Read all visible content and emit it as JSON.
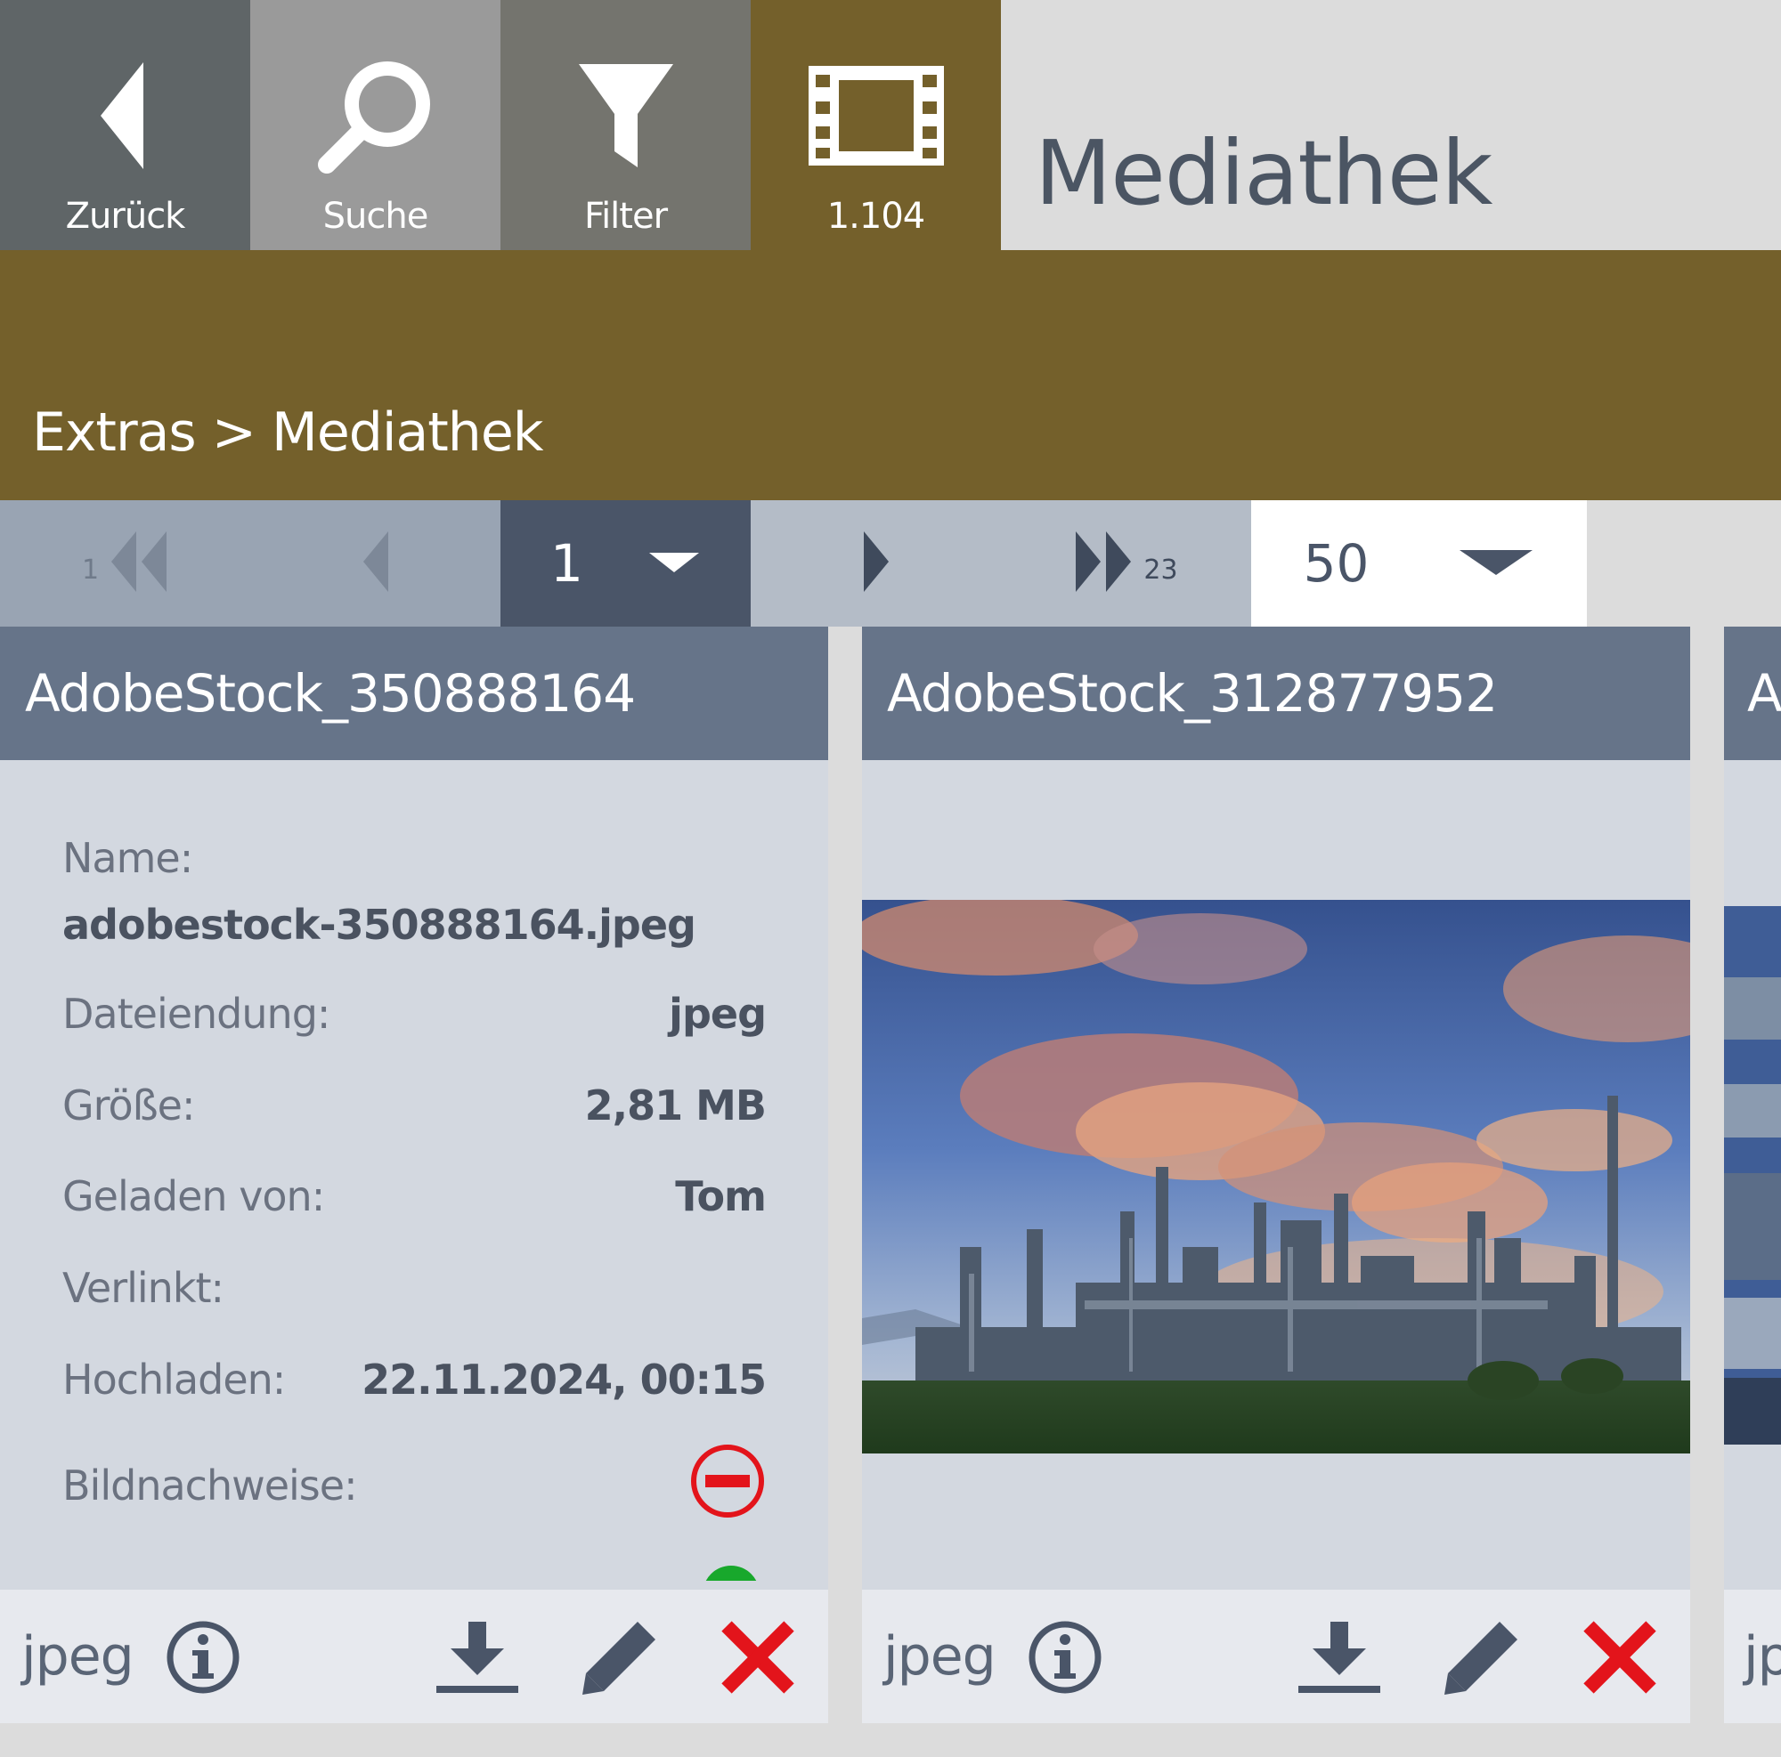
{
  "toolbar": {
    "back_label": "Zurück",
    "search_label": "Suche",
    "filter_label": "Filter",
    "media_count": "1.104",
    "title": "Mediathek"
  },
  "breadcrumb": "Extras > Mediathek",
  "pagination": {
    "first_page": "1",
    "current_page": "1",
    "last_page": "23",
    "page_size": "50"
  },
  "cards": [
    {
      "title": "AdobeStock_350888164",
      "labels": {
        "name": "Name:",
        "extension": "Dateiendung:",
        "size": "Größe:",
        "uploaded_by": "Geladen von:",
        "linked": "Verlinkt:",
        "upload_date": "Hochladen:",
        "credits": "Bildnachweise:"
      },
      "name": "adobestock-350888164.jpeg",
      "extension": "jpeg",
      "size": "2,81 MB",
      "uploaded_by": "Tom",
      "upload_date": "22.11.2024, 00:15",
      "footer_type": "jpeg"
    },
    {
      "title": "AdobeStock_312877952",
      "footer_type": "jpeg"
    },
    {
      "title": "A",
      "footer_type": "jp"
    }
  ],
  "colors": {
    "accent": "#74602b",
    "header": "#667489",
    "delete": "#e3141b"
  }
}
